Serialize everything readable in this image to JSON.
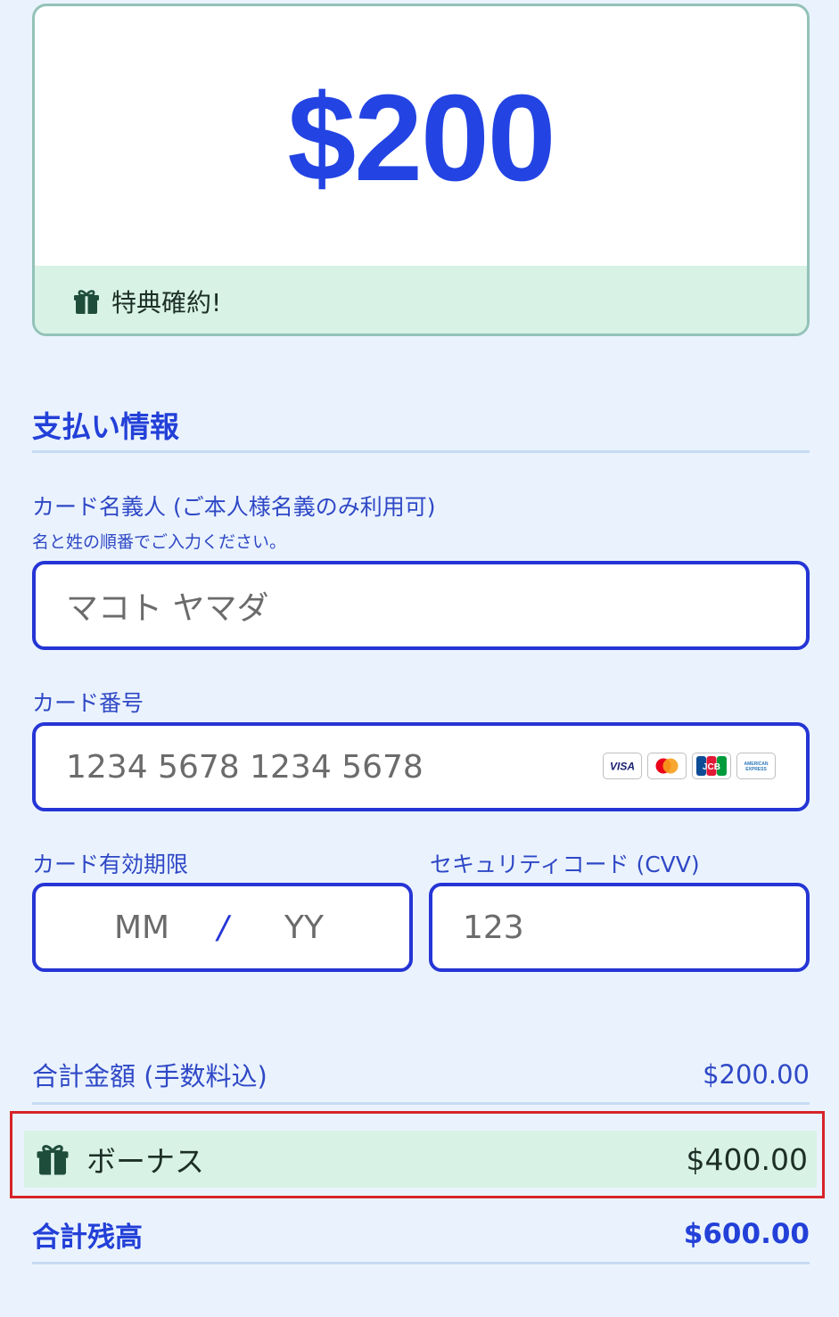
{
  "amount_card": {
    "amount": "$200",
    "perk_text": "特典確約!"
  },
  "payment": {
    "section_title": "支払い情報",
    "cardholder": {
      "label": "カード名義人 (ご本人様名義のみ利用可)",
      "hint": "名と姓の順番でご入力ください。",
      "placeholder": "マコト ヤマダ"
    },
    "card_number": {
      "label": "カード番号",
      "placeholder": "1234 5678 1234 5678",
      "brands": [
        "VISA",
        "Mastercard",
        "JCB",
        "AMERICAN EXPRESS"
      ]
    },
    "expiry": {
      "label": "カード有効期限",
      "month_placeholder": "MM",
      "separator": "/",
      "year_placeholder": "YY"
    },
    "cvv": {
      "label": "セキュリティコード (CVV)",
      "placeholder": "123"
    }
  },
  "summary": {
    "total_label": "合計金額 (手数料込)",
    "total_value": "$200.00",
    "bonus_label": "ボーナス",
    "bonus_value": "$400.00",
    "balance_label": "合計残高",
    "balance_value": "$600.00"
  },
  "colors": {
    "accent": "#2340d8",
    "background": "#eaf3fd",
    "perk_background": "#d8f2e6",
    "highlight_border": "#d7232a"
  }
}
